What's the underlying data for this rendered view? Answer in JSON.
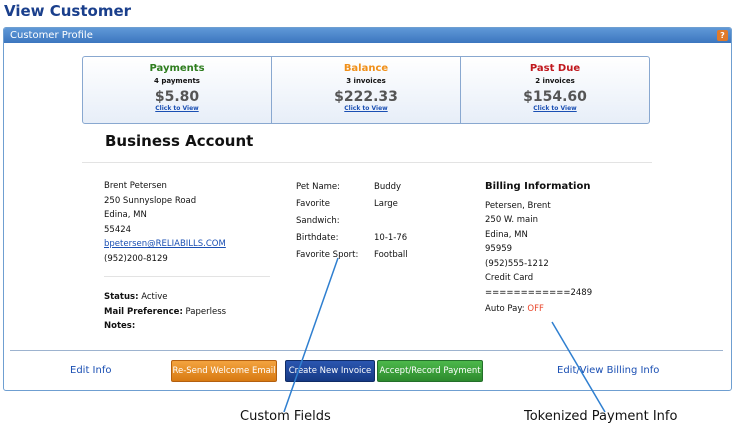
{
  "page": {
    "title": "View Customer"
  },
  "panel": {
    "title": "Customer Profile",
    "help_glyph": "?"
  },
  "summary": [
    {
      "label": "Payments",
      "sub": "4 payments",
      "amount": "$5.80",
      "link": "Click to View",
      "color": "#2e7d1f"
    },
    {
      "label": "Balance",
      "sub": "3 invoices",
      "amount": "$222.33",
      "link": "Click to View",
      "color": "#f0901a"
    },
    {
      "label": "Past Due",
      "sub": "2 invoices",
      "amount": "$154.60",
      "link": "Click to View",
      "color": "#c0181e"
    }
  ],
  "account": {
    "title": "Business Account",
    "name": "Brent Petersen",
    "street": "250 Sunnyslope Road",
    "city": "Edina, MN",
    "zip": "55424",
    "email": "bpetersen@RELIABILLS.COM",
    "phone": "(952)200-8129",
    "status_label": "Status:",
    "status_value": "Active",
    "mail_label": "Mail Preference:",
    "mail_value": "Paperless",
    "notes_label": "Notes:"
  },
  "custom_fields": [
    {
      "key": "Pet Name:",
      "value": "Buddy"
    },
    {
      "key": "Favorite Sandwich:",
      "value": "Large"
    },
    {
      "key": "Birthdate:",
      "value": "10-1-76"
    },
    {
      "key": "Favorite Sport:",
      "value": "Football"
    }
  ],
  "billing": {
    "title": "Billing Information",
    "name": "Petersen, Brent",
    "street": "250 W. main",
    "city": "Edina, MN",
    "zip": "95959",
    "phone": "(952)555-1212",
    "method": "Credit Card",
    "card": "============2489",
    "autopay_label": "Auto Pay:",
    "autopay_value": "OFF"
  },
  "footer": {
    "edit_info": "Edit Info",
    "resend": "Re-Send Welcome Email",
    "new_invoice": "Create New Invoice",
    "record_payment": "Accept/Record Payment",
    "billing_info": "Edit/View Billing Info"
  },
  "annotations": {
    "custom_fields": "Custom Fields",
    "tokenized": "Tokenized Payment Info"
  }
}
